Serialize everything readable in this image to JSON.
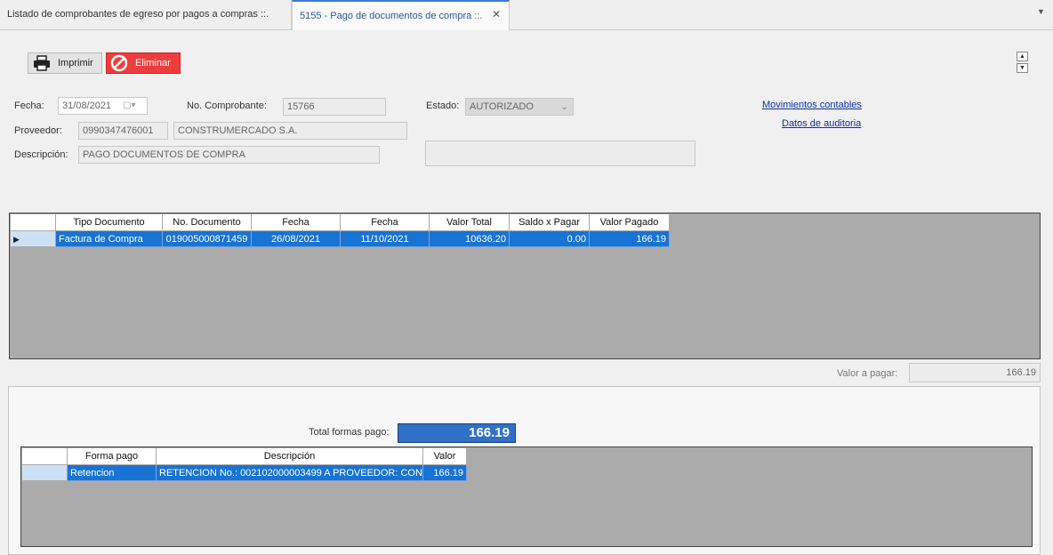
{
  "tabs": [
    {
      "label": "Listado de comprobantes de egreso por pagos a compras ::.",
      "active": false
    },
    {
      "label": "5155 - Pago de documentos de compra ::.",
      "active": true
    }
  ],
  "toolbar": {
    "print_label": "Imprimir",
    "delete_label": "Eliminar"
  },
  "form": {
    "fecha_label": "Fecha:",
    "fecha_value": "31/08/2021",
    "comprobante_label": "No. Comprobante:",
    "comprobante_value": "15766",
    "estado_label": "Estado:",
    "estado_value": "AUTORIZADO",
    "proveedor_label": "Proveedor:",
    "proveedor_ruc": "0990347476001",
    "proveedor_name": "CONSTRUMERCADO S.A.",
    "descripcion_label": "Descripción:",
    "descripcion_value": "PAGO DOCUMENTOS DE COMPRA"
  },
  "links": {
    "movimientos": "Movimientos contables",
    "auditoria": "Datos de auditoria"
  },
  "documents_grid": {
    "columns": [
      "Tipo Documento",
      "No. Documento",
      "Fecha",
      "Fecha",
      "Valor Total",
      "Saldo x Pagar",
      "Valor Pagado"
    ],
    "rows": [
      [
        "Factura de Compra",
        "019005000871459",
        "26/08/2021",
        "11/10/2021",
        "10636.20",
        "0.00",
        "166.19"
      ]
    ]
  },
  "valor_pagar": {
    "label": "Valor a pagar:",
    "value": "166.19"
  },
  "total_formas": {
    "label": "Total formas pago:",
    "value": "166.19"
  },
  "payments_grid": {
    "columns": [
      "Forma pago",
      "Descripción",
      "Valor"
    ],
    "rows": [
      [
        "Retencion",
        "RETENCION No.: 002102000003499 A PROVEEDOR: CON...",
        "166.19"
      ]
    ]
  }
}
